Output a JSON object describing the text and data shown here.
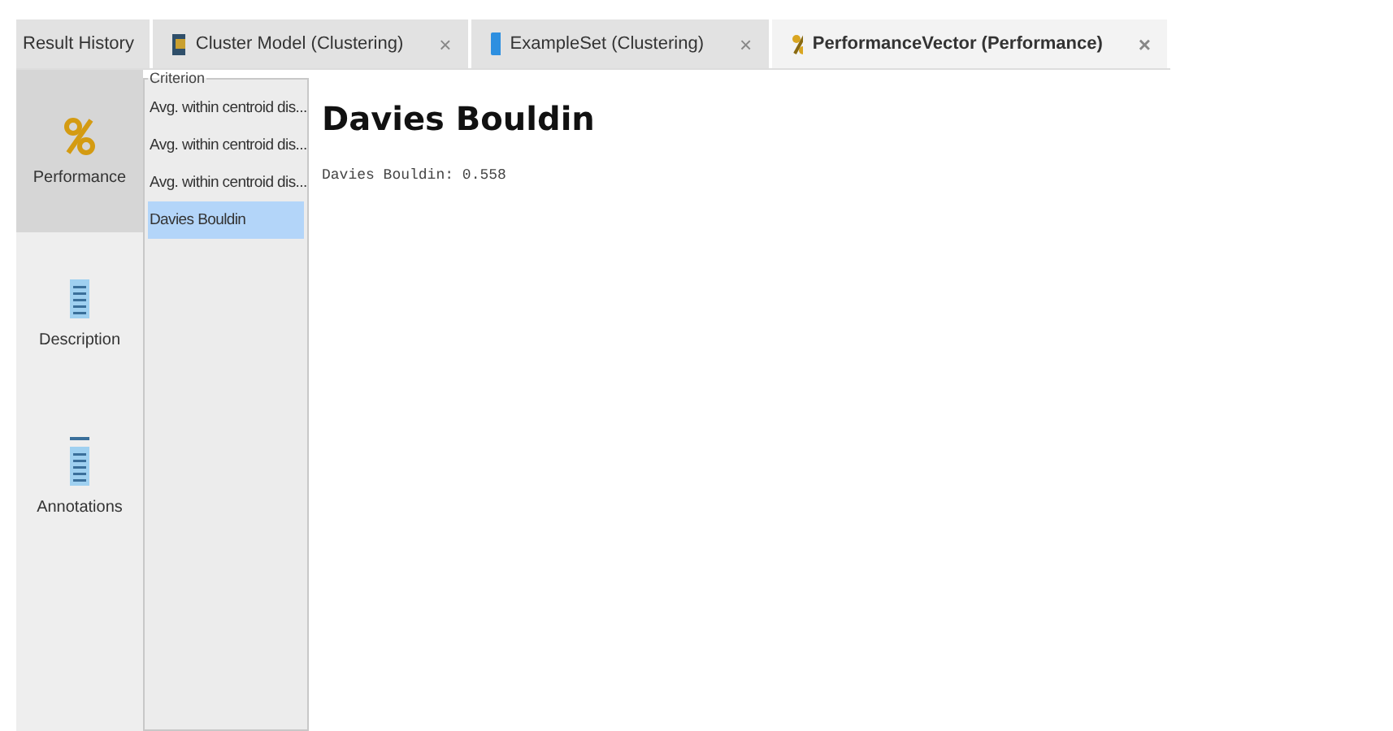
{
  "tabs": [
    {
      "kind": "history",
      "label": "Result History",
      "selected": false,
      "closable": false
    },
    {
      "kind": "cluster",
      "label": "Cluster Model (Clustering)",
      "selected": false,
      "closable": true
    },
    {
      "kind": "table",
      "label": "ExampleSet (Clustering)",
      "selected": false,
      "closable": true
    },
    {
      "kind": "performance",
      "label": "PerformanceVector (Performance)",
      "selected": true,
      "closable": true
    }
  ],
  "close_glyph": "×",
  "views": [
    {
      "kind": "percent",
      "label": "Performance",
      "selected": true
    },
    {
      "kind": "document",
      "label": "Description",
      "selected": false
    },
    {
      "kind": "annotations",
      "label": "Annotations",
      "selected": false
    }
  ],
  "criterion": {
    "title": "Criterion",
    "items": [
      {
        "label": "Avg. within centroid dis...",
        "selected": false
      },
      {
        "label": "Avg. within centroid dis...",
        "selected": false
      },
      {
        "label": "Avg. within centroid dis...",
        "selected": false
      },
      {
        "label": "Davies Bouldin",
        "selected": true
      }
    ]
  },
  "content": {
    "heading": "Davies Bouldin",
    "value_line": "Davies Bouldin: 0.558"
  }
}
